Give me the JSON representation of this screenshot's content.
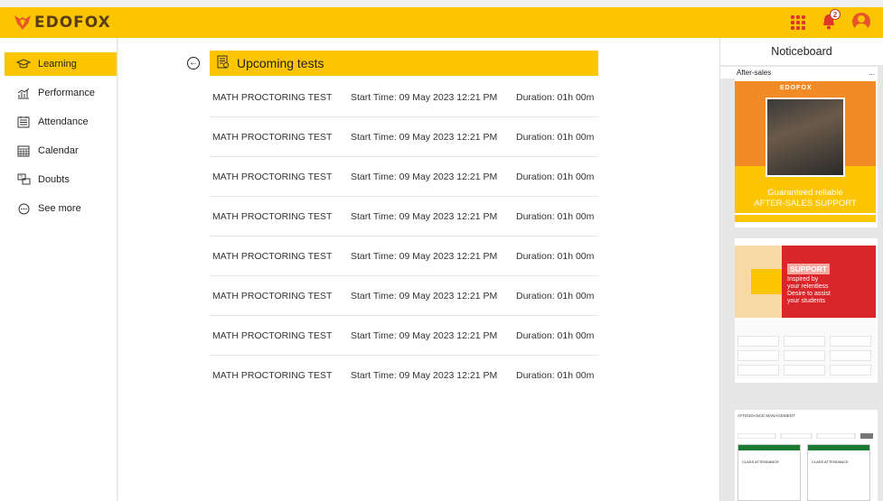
{
  "brand": {
    "name": "EDOFOX"
  },
  "header": {
    "notification_count": "2"
  },
  "sidebar": {
    "items": [
      {
        "label": "Learning",
        "icon": "graduation-cap-icon"
      },
      {
        "label": "Performance",
        "icon": "chart-icon"
      },
      {
        "label": "Attendance",
        "icon": "attendance-icon"
      },
      {
        "label": "Calendar",
        "icon": "calendar-icon"
      },
      {
        "label": "Doubts",
        "icon": "doubts-icon"
      },
      {
        "label": "See more",
        "icon": "more-icon"
      }
    ]
  },
  "main": {
    "title": "Upcoming tests",
    "tests": [
      {
        "name": "MATH PROCTORING TEST",
        "start": "Start Time: 09 May 2023 12:21 PM",
        "duration": "Duration: 01h 00m"
      },
      {
        "name": "MATH PROCTORING TEST",
        "start": "Start Time: 09 May 2023 12:21 PM",
        "duration": "Duration: 01h 00m"
      },
      {
        "name": "MATH PROCTORING TEST",
        "start": "Start Time: 09 May 2023 12:21 PM",
        "duration": "Duration: 01h 00m"
      },
      {
        "name": "MATH PROCTORING TEST",
        "start": "Start Time: 09 May 2023 12:21 PM",
        "duration": "Duration: 01h 00m"
      },
      {
        "name": "MATH PROCTORING TEST",
        "start": "Start Time: 09 May 2023 12:21 PM",
        "duration": "Duration: 01h 00m"
      },
      {
        "name": "MATH PROCTORING TEST",
        "start": "Start Time: 09 May 2023 12:21 PM",
        "duration": "Duration: 01h 00m"
      },
      {
        "name": "MATH PROCTORING TEST",
        "start": "Start Time: 09 May 2023 12:21 PM",
        "duration": "Duration: 01h 00m"
      },
      {
        "name": "MATH PROCTORING TEST",
        "start": "Start Time: 09 May 2023 12:21 PM",
        "duration": "Duration: 01h 00m"
      }
    ]
  },
  "noticeboard": {
    "title": "Noticeboard",
    "card1": {
      "label": "After-sales",
      "menu": "...",
      "brand": "EDOFOX",
      "line1": "Guaranteed reliable",
      "line2": "AFTER-SALES SUPPORT"
    },
    "card2": {
      "label": "SUPPORT",
      "line1": "Inspired by",
      "line2": "your relentless",
      "line3": "Desire to assist",
      "line4": "your students"
    },
    "card3": {
      "caption": "ATTENDANCE MANAGEMENT",
      "col1": "CLASS ATTENDANCE",
      "col2": "CLASS ATTENDANCE"
    }
  },
  "colors": {
    "accent": "#fcc501",
    "brand_red": "#e0362c"
  }
}
